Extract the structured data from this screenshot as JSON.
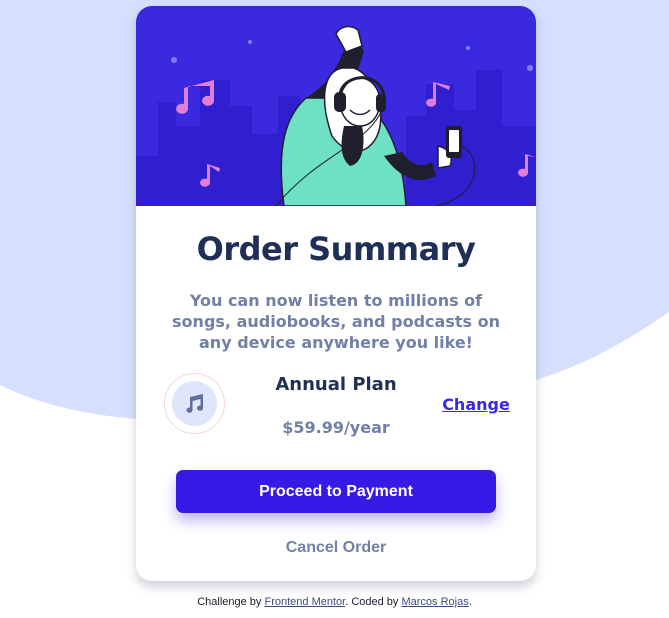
{
  "colors": {
    "background_wave": "#d6e0fe",
    "hero_bg": "#3b29e0",
    "hero_buildings": "#2f1fcf",
    "accent_button": "#381ae6",
    "title": "#1f2f56",
    "muted_text": "#7280a7",
    "change_link": "#382ae1",
    "music_note": "#e07dd8"
  },
  "card": {
    "title": "Order Summary",
    "description": "You can now listen to millions of songs, audiobooks, and podcasts on any device anywhere you like!",
    "plan": {
      "icon": "music-note-icon",
      "name": "Annual Plan",
      "price": "$59.99/year",
      "change_label": "Change"
    },
    "proceed_label": "Proceed to Payment",
    "cancel_label": "Cancel Order"
  },
  "attribution": {
    "prefix": "Challenge by ",
    "challenge_link": "Frontend Mentor",
    "middle": ". Coded by ",
    "author_link": "Marcos Rojas",
    "suffix": "."
  }
}
